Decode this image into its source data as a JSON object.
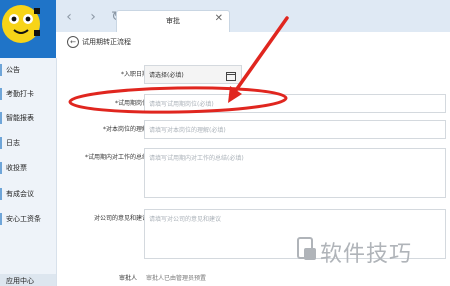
{
  "tab": {
    "title": "审批",
    "close": "✕"
  },
  "nav": {
    "back": "‹",
    "forward": "›",
    "refresh": "↻"
  },
  "sidebar": {
    "items": [
      {
        "label": "公告"
      },
      {
        "label": "考勤打卡"
      },
      {
        "label": "智能报表"
      },
      {
        "label": "日志"
      },
      {
        "label": "收投票"
      },
      {
        "label": "有成会议"
      },
      {
        "label": "安心工资条"
      }
    ],
    "footer": "应用中心"
  },
  "page": {
    "title": "试用期转正流程",
    "back_symbol": "←"
  },
  "form": {
    "entry_date": {
      "label": "*入职日期",
      "value": "请选择(必填)"
    },
    "position": {
      "label": "*试用期岗位",
      "placeholder": "请填写试用期岗位(必填)"
    },
    "understanding": {
      "label": "*对本岗位的理解",
      "placeholder": "请填写对本岗位的理解(必填)"
    },
    "summary": {
      "label": "*试用期内对工作的总结",
      "placeholder": "请填写试用期内对工作的总结(必填)"
    },
    "suggestions": {
      "label": "对公司的意见和建议",
      "placeholder": "请填写对公司的意见和建议"
    },
    "approver": {
      "label": "审批人",
      "text": "审批人已由管理员预置"
    }
  },
  "watermark": {
    "text": "软件技巧"
  },
  "colors": {
    "sidebar_header": "#1f74c8",
    "annotation": "#e0261f",
    "accent_bar": "#6fa5d8"
  }
}
